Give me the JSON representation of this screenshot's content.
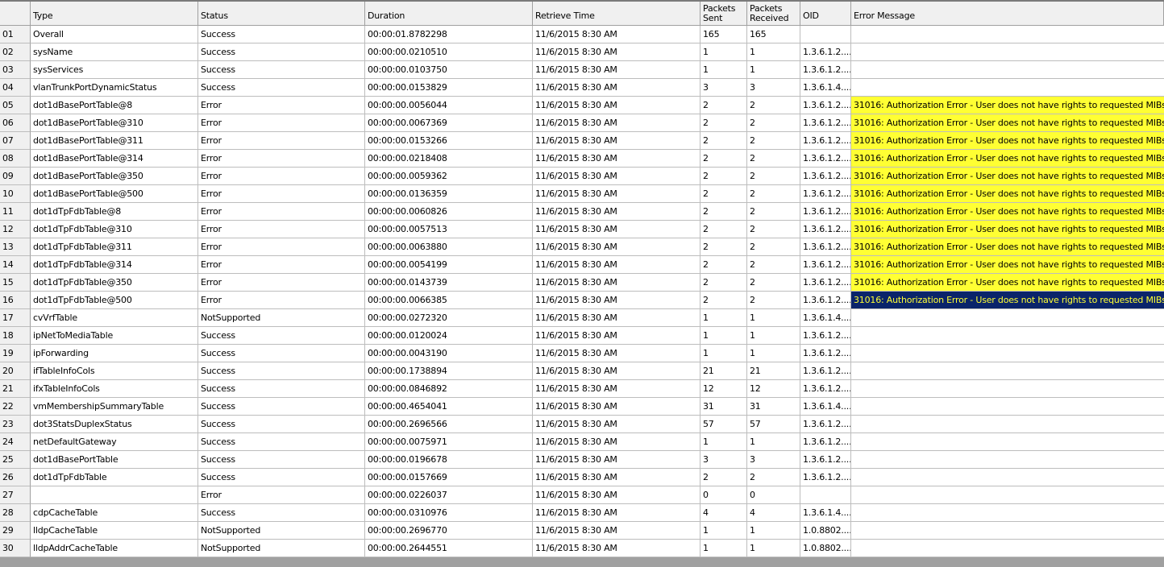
{
  "columns": [
    "",
    "Type",
    "Status",
    "Duration",
    "Retrieve Time",
    "Packets Sent",
    "Packets Received",
    "OID",
    "Error Message"
  ],
  "rows": [
    {
      "num": "01",
      "type": "Overall",
      "status": "Success",
      "duration": "00:00:01.8782298",
      "time": "11/6/2015 8:30 AM",
      "sent": "165",
      "received": "165",
      "oid": "",
      "error": ""
    },
    {
      "num": "02",
      "type": "sysName",
      "status": "Success",
      "duration": "00:00:00.0210510",
      "time": "11/6/2015 8:30 AM",
      "sent": "1",
      "received": "1",
      "oid": "1.3.6.1.2....",
      "error": ""
    },
    {
      "num": "03",
      "type": "sysServices",
      "status": "Success",
      "duration": "00:00:00.0103750",
      "time": "11/6/2015 8:30 AM",
      "sent": "1",
      "received": "1",
      "oid": "1.3.6.1.2....",
      "error": ""
    },
    {
      "num": "04",
      "type": "vlanTrunkPortDynamicStatus",
      "status": "Success",
      "duration": "00:00:00.0153829",
      "time": "11/6/2015 8:30 AM",
      "sent": "3",
      "received": "3",
      "oid": "1.3.6.1.4....",
      "error": ""
    },
    {
      "num": "05",
      "type": "dot1dBasePortTable@8",
      "status": "Error",
      "duration": "00:00:00.0056044",
      "time": "11/6/2015 8:30 AM",
      "sent": "2",
      "received": "2",
      "oid": "1.3.6.1.2....",
      "error": "31016: Authorization Error - User does not have rights to requested MIBs",
      "highlight": "yellow"
    },
    {
      "num": "06",
      "type": "dot1dBasePortTable@310",
      "status": "Error",
      "duration": "00:00:00.0067369",
      "time": "11/6/2015 8:30 AM",
      "sent": "2",
      "received": "2",
      "oid": "1.3.6.1.2....",
      "error": "31016: Authorization Error - User does not have rights to requested MIBs",
      "highlight": "yellow"
    },
    {
      "num": "07",
      "type": "dot1dBasePortTable@311",
      "status": "Error",
      "duration": "00:00:00.0153266",
      "time": "11/6/2015 8:30 AM",
      "sent": "2",
      "received": "2",
      "oid": "1.3.6.1.2....",
      "error": "31016: Authorization Error - User does not have rights to requested MIBs",
      "highlight": "yellow"
    },
    {
      "num": "08",
      "type": "dot1dBasePortTable@314",
      "status": "Error",
      "duration": "00:00:00.0218408",
      "time": "11/6/2015 8:30 AM",
      "sent": "2",
      "received": "2",
      "oid": "1.3.6.1.2....",
      "error": "31016: Authorization Error - User does not have rights to requested MIBs",
      "highlight": "yellow"
    },
    {
      "num": "09",
      "type": "dot1dBasePortTable@350",
      "status": "Error",
      "duration": "00:00:00.0059362",
      "time": "11/6/2015 8:30 AM",
      "sent": "2",
      "received": "2",
      "oid": "1.3.6.1.2....",
      "error": "31016: Authorization Error - User does not have rights to requested MIBs",
      "highlight": "yellow"
    },
    {
      "num": "10",
      "type": "dot1dBasePortTable@500",
      "status": "Error",
      "duration": "00:00:00.0136359",
      "time": "11/6/2015 8:30 AM",
      "sent": "2",
      "received": "2",
      "oid": "1.3.6.1.2....",
      "error": "31016: Authorization Error - User does not have rights to requested MIBs",
      "highlight": "yellow"
    },
    {
      "num": "11",
      "type": "dot1dTpFdbTable@8",
      "status": "Error",
      "duration": "00:00:00.0060826",
      "time": "11/6/2015 8:30 AM",
      "sent": "2",
      "received": "2",
      "oid": "1.3.6.1.2....",
      "error": "31016: Authorization Error - User does not have rights to requested MIBs",
      "highlight": "yellow"
    },
    {
      "num": "12",
      "type": "dot1dTpFdbTable@310",
      "status": "Error",
      "duration": "00:00:00.0057513",
      "time": "11/6/2015 8:30 AM",
      "sent": "2",
      "received": "2",
      "oid": "1.3.6.1.2....",
      "error": "31016: Authorization Error - User does not have rights to requested MIBs",
      "highlight": "yellow"
    },
    {
      "num": "13",
      "type": "dot1dTpFdbTable@311",
      "status": "Error",
      "duration": "00:00:00.0063880",
      "time": "11/6/2015 8:30 AM",
      "sent": "2",
      "received": "2",
      "oid": "1.3.6.1.2....",
      "error": "31016: Authorization Error - User does not have rights to requested MIBs",
      "highlight": "yellow"
    },
    {
      "num": "14",
      "type": "dot1dTpFdbTable@314",
      "status": "Error",
      "duration": "00:00:00.0054199",
      "time": "11/6/2015 8:30 AM",
      "sent": "2",
      "received": "2",
      "oid": "1.3.6.1.2....",
      "error": "31016: Authorization Error - User does not have rights to requested MIBs",
      "highlight": "yellow"
    },
    {
      "num": "15",
      "type": "dot1dTpFdbTable@350",
      "status": "Error",
      "duration": "00:00:00.0143739",
      "time": "11/6/2015 8:30 AM",
      "sent": "2",
      "received": "2",
      "oid": "1.3.6.1.2....",
      "error": "31016: Authorization Error - User does not have rights to requested MIBs",
      "highlight": "yellow"
    },
    {
      "num": "16",
      "type": "dot1dTpFdbTable@500",
      "status": "Error",
      "duration": "00:00:00.0066385",
      "time": "11/6/2015 8:30 AM",
      "sent": "2",
      "received": "2",
      "oid": "1.3.6.1.2....",
      "error": "31016: Authorization Error - User does not have rights to requested MIBs",
      "highlight": "selected"
    },
    {
      "num": "17",
      "type": "cvVrfTable",
      "status": "NotSupported",
      "duration": "00:00:00.0272320",
      "time": "11/6/2015 8:30 AM",
      "sent": "1",
      "received": "1",
      "oid": "1.3.6.1.4....",
      "error": ""
    },
    {
      "num": "18",
      "type": "ipNetToMediaTable",
      "status": "Success",
      "duration": "00:00:00.0120024",
      "time": "11/6/2015 8:30 AM",
      "sent": "1",
      "received": "1",
      "oid": "1.3.6.1.2....",
      "error": ""
    },
    {
      "num": "19",
      "type": "ipForwarding",
      "status": "Success",
      "duration": "00:00:00.0043190",
      "time": "11/6/2015 8:30 AM",
      "sent": "1",
      "received": "1",
      "oid": "1.3.6.1.2....",
      "error": ""
    },
    {
      "num": "20",
      "type": "ifTableInfoCols",
      "status": "Success",
      "duration": "00:00:00.1738894",
      "time": "11/6/2015 8:30 AM",
      "sent": "21",
      "received": "21",
      "oid": "1.3.6.1.2....",
      "error": ""
    },
    {
      "num": "21",
      "type": "ifxTableInfoCols",
      "status": "Success",
      "duration": "00:00:00.0846892",
      "time": "11/6/2015 8:30 AM",
      "sent": "12",
      "received": "12",
      "oid": "1.3.6.1.2....",
      "error": ""
    },
    {
      "num": "22",
      "type": "vmMembershipSummaryTable",
      "status": "Success",
      "duration": "00:00:00.4654041",
      "time": "11/6/2015 8:30 AM",
      "sent": "31",
      "received": "31",
      "oid": "1.3.6.1.4....",
      "error": ""
    },
    {
      "num": "23",
      "type": "dot3StatsDuplexStatus",
      "status": "Success",
      "duration": "00:00:00.2696566",
      "time": "11/6/2015 8:30 AM",
      "sent": "57",
      "received": "57",
      "oid": "1.3.6.1.2....",
      "error": ""
    },
    {
      "num": "24",
      "type": "netDefaultGateway",
      "status": "Success",
      "duration": "00:00:00.0075971",
      "time": "11/6/2015 8:30 AM",
      "sent": "1",
      "received": "1",
      "oid": "1.3.6.1.2....",
      "error": ""
    },
    {
      "num": "25",
      "type": "dot1dBasePortTable",
      "status": "Success",
      "duration": "00:00:00.0196678",
      "time": "11/6/2015 8:30 AM",
      "sent": "3",
      "received": "3",
      "oid": "1.3.6.1.2....",
      "error": ""
    },
    {
      "num": "26",
      "type": "dot1dTpFdbTable",
      "status": "Success",
      "duration": "00:00:00.0157669",
      "time": "11/6/2015 8:30 AM",
      "sent": "2",
      "received": "2",
      "oid": "1.3.6.1.2....",
      "error": ""
    },
    {
      "num": "27",
      "type": "",
      "status": "Error",
      "duration": "00:00:00.0226037",
      "time": "11/6/2015 8:30 AM",
      "sent": "0",
      "received": "0",
      "oid": "",
      "error": ""
    },
    {
      "num": "28",
      "type": "cdpCacheTable",
      "status": "Success",
      "duration": "00:00:00.0310976",
      "time": "11/6/2015 8:30 AM",
      "sent": "4",
      "received": "4",
      "oid": "1.3.6.1.4....",
      "error": ""
    },
    {
      "num": "29",
      "type": "lldpCacheTable",
      "status": "NotSupported",
      "duration": "00:00:00.2696770",
      "time": "11/6/2015 8:30 AM",
      "sent": "1",
      "received": "1",
      "oid": "1.0.8802....",
      "error": ""
    },
    {
      "num": "30",
      "type": "lldpAddrCacheTable",
      "status": "NotSupported",
      "duration": "00:00:00.2644551",
      "time": "11/6/2015 8:30 AM",
      "sent": "1",
      "received": "1",
      "oid": "1.0.8802....",
      "error": ""
    }
  ],
  "colors": {
    "highlight": "#ffff33",
    "selected_bg": "#0a246a",
    "selected_fg": "#ffff33"
  }
}
